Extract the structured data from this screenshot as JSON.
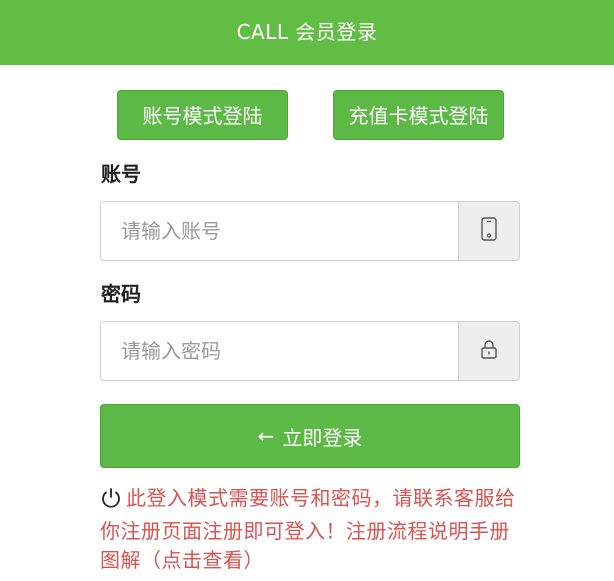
{
  "header": {
    "title": "CALL 会员登录"
  },
  "modes": {
    "account_label": "账号模式登陆",
    "card_label": "充值卡模式登陆"
  },
  "account": {
    "label": "账号",
    "placeholder": "请输入账号",
    "icon": "phone-icon"
  },
  "password": {
    "label": "密码",
    "placeholder": "请输入密码",
    "icon": "lock-icon"
  },
  "submit": {
    "arrow": "←",
    "label": "立即登录"
  },
  "notice": {
    "icon": "power-icon",
    "text": "此登入模式需要账号和密码，请联系客服给你注册页面注册即可登入！",
    "link_text": "注册流程说明手册图解（点击查看）"
  },
  "colors": {
    "brand_green": "#62bd44",
    "notice_red": "#d9534f"
  }
}
